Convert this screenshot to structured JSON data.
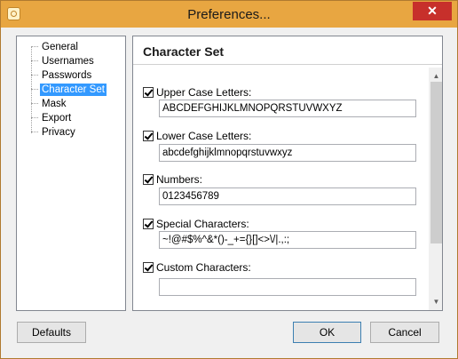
{
  "window": {
    "title": "Preferences...",
    "close_glyph": "✕",
    "app_icon": "lock-icon"
  },
  "sidebar": {
    "items": [
      {
        "label": "General",
        "selected": false
      },
      {
        "label": "Usernames",
        "selected": false
      },
      {
        "label": "Passwords",
        "selected": false
      },
      {
        "label": "Character Set",
        "selected": true
      },
      {
        "label": "Mask",
        "selected": false
      },
      {
        "label": "Export",
        "selected": false
      },
      {
        "label": "Privacy",
        "selected": false
      }
    ]
  },
  "panel": {
    "title": "Character Set",
    "fields": [
      {
        "label": "Upper Case Letters:",
        "checked": true,
        "value": "ABCDEFGHIJKLMNOPQRSTUVWXYZ"
      },
      {
        "label": "Lower Case Letters:",
        "checked": true,
        "value": "abcdefghijklmnopqrstuvwxyz"
      },
      {
        "label": "Numbers:",
        "checked": true,
        "value": "0123456789"
      },
      {
        "label": "Special Characters:",
        "checked": true,
        "value": "~!@#$%^&*()-_+={}[]<>\\/|.,:;"
      },
      {
        "label": "Custom Characters:",
        "checked": true,
        "value": ""
      }
    ],
    "scroll_up_glyph": "▲",
    "scroll_down_glyph": "▼"
  },
  "buttons": {
    "defaults": "Defaults",
    "ok": "OK",
    "cancel": "Cancel"
  }
}
